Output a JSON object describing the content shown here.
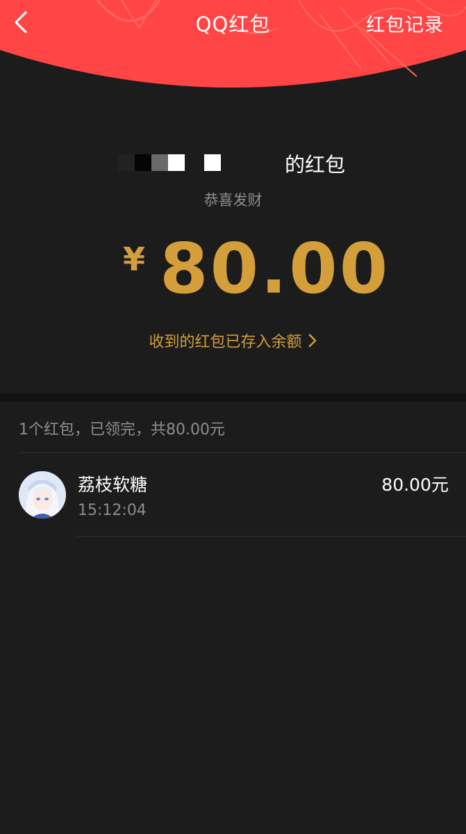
{
  "header": {
    "title": "QQ红包",
    "records_label": "红包记录",
    "bg_color": "#ff4545",
    "back_icon": "chevron-left-icon"
  },
  "packet": {
    "sender_suffix": "的红包",
    "blessing": "恭喜发财",
    "currency": "¥",
    "amount": "80.00",
    "balance_link": "收到的红包已存入余额",
    "accent_color": "#d49e3b"
  },
  "summary": {
    "text": "1个红包，已领完，共80.00元"
  },
  "receivers": [
    {
      "name": "荔枝软糖",
      "time": "15:12:04",
      "amount": "80.00元"
    }
  ]
}
